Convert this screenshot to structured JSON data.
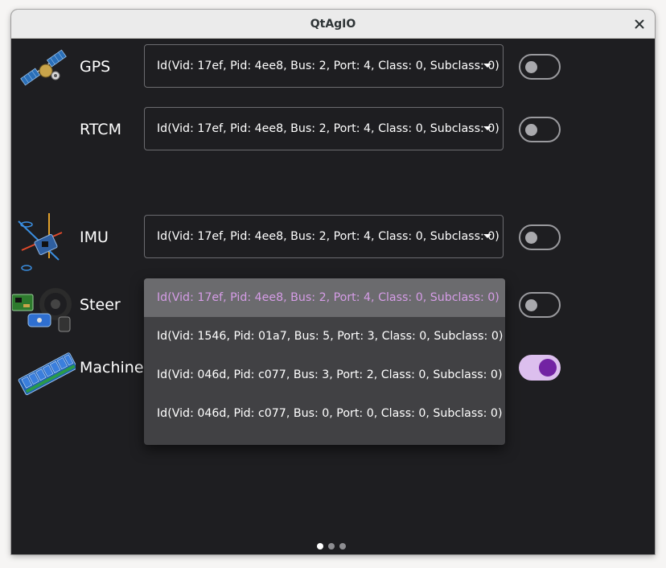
{
  "window": {
    "title": "QtAgIO"
  },
  "rows": [
    {
      "label": "GPS",
      "icon": "satellite-icon",
      "value": "Id(Vid: 17ef, Pid: 4ee8, Bus: 2, Port: 4, Class: 0, Subclass: 0)",
      "enabled": false
    },
    {
      "label": "RTCM",
      "icon": "",
      "value": "Id(Vid: 17ef, Pid: 4ee8, Bus: 2, Port: 4, Class: 0, Subclass: 0)",
      "enabled": false
    },
    {
      "label": "IMU",
      "icon": "imu-axes-icon",
      "value": "Id(Vid: 17ef, Pid: 4ee8, Bus: 2, Port: 4, Class: 0, Subclass: 0)",
      "enabled": false
    },
    {
      "label": "Steer",
      "icon": "steering-wheel-icon",
      "enabled": false
    },
    {
      "label": "Machine",
      "icon": "relay-board-icon",
      "enabled": true
    }
  ],
  "dropdown": {
    "options": [
      "Id(Vid: 17ef, Pid: 4ee8, Bus: 2, Port: 4, Class: 0, Subclass: 0)",
      "Id(Vid: 1546, Pid: 01a7, Bus: 5, Port: 3, Class: 0, Subclass: 0)",
      "Id(Vid: 046d, Pid: c077, Bus: 3, Port: 2, Class: 0, Subclass: 0)",
      "Id(Vid: 046d, Pid: c077, Bus: 0, Port: 0, Class: 0, Subclass: 0)"
    ],
    "selected_index": 0
  },
  "page_indicator": {
    "count": 3,
    "current": 1
  },
  "colors": {
    "background": "#1e1e21",
    "accent": "#7223a3",
    "accent_track": "#dcbfee",
    "selected_text": "#d59ce6"
  }
}
